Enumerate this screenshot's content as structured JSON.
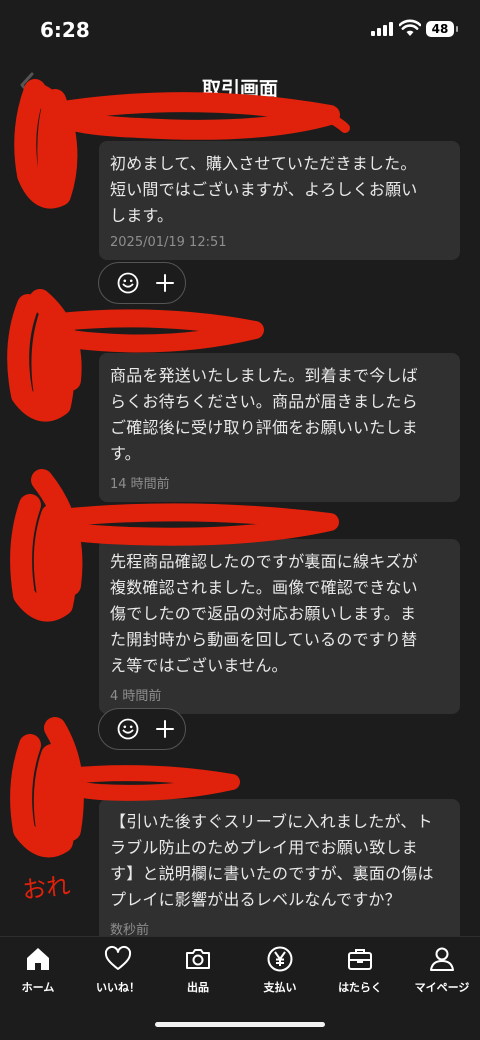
{
  "status_bar": {
    "time": "6:28",
    "battery": "48"
  },
  "header": {
    "title": "取引画面"
  },
  "messages": [
    {
      "text": "初めまして、購入させていただきました。\n短い間ではございますが、よろしくお願い\nします。",
      "timestamp": "2025/01/19 12:51"
    },
    {
      "text": "商品を発送いたしました。到着まで今しば\nらくお待ちください。商品が届きましたら\nご確認後に受け取り評価をお願いいたしま\nす。",
      "timestamp": "14 時間前"
    },
    {
      "text": "先程商品確認したのですが裏面に線キズが\n複数確認されました。画像で確認できない\n傷でしたので返品の対応お願いします。ま\nた開封時から動画を回しているのですり替\nえ等ではございません。",
      "timestamp": "4 時間前"
    },
    {
      "text": "【引いた後すぐスリーブに入れましたが、ト\nラブル防止のためプレイ用でお願い致しま\nす】と説明欄に書いたのですが、裏面の傷は\nプレイに影響が出るレベルなんですか？",
      "timestamp": "数秒前"
    }
  ],
  "annotation": {
    "label": "おれ",
    "color": "#e0210b"
  },
  "tab_bar": {
    "items": [
      {
        "label": "ホーム",
        "icon": "home-icon"
      },
      {
        "label": "いいね！",
        "icon": "heart-icon"
      },
      {
        "label": "出品",
        "icon": "camera-icon"
      },
      {
        "label": "支払い",
        "icon": "yen-icon"
      },
      {
        "label": "はたらく",
        "icon": "briefcase-icon"
      },
      {
        "label": "マイページ",
        "icon": "person-icon"
      }
    ]
  }
}
